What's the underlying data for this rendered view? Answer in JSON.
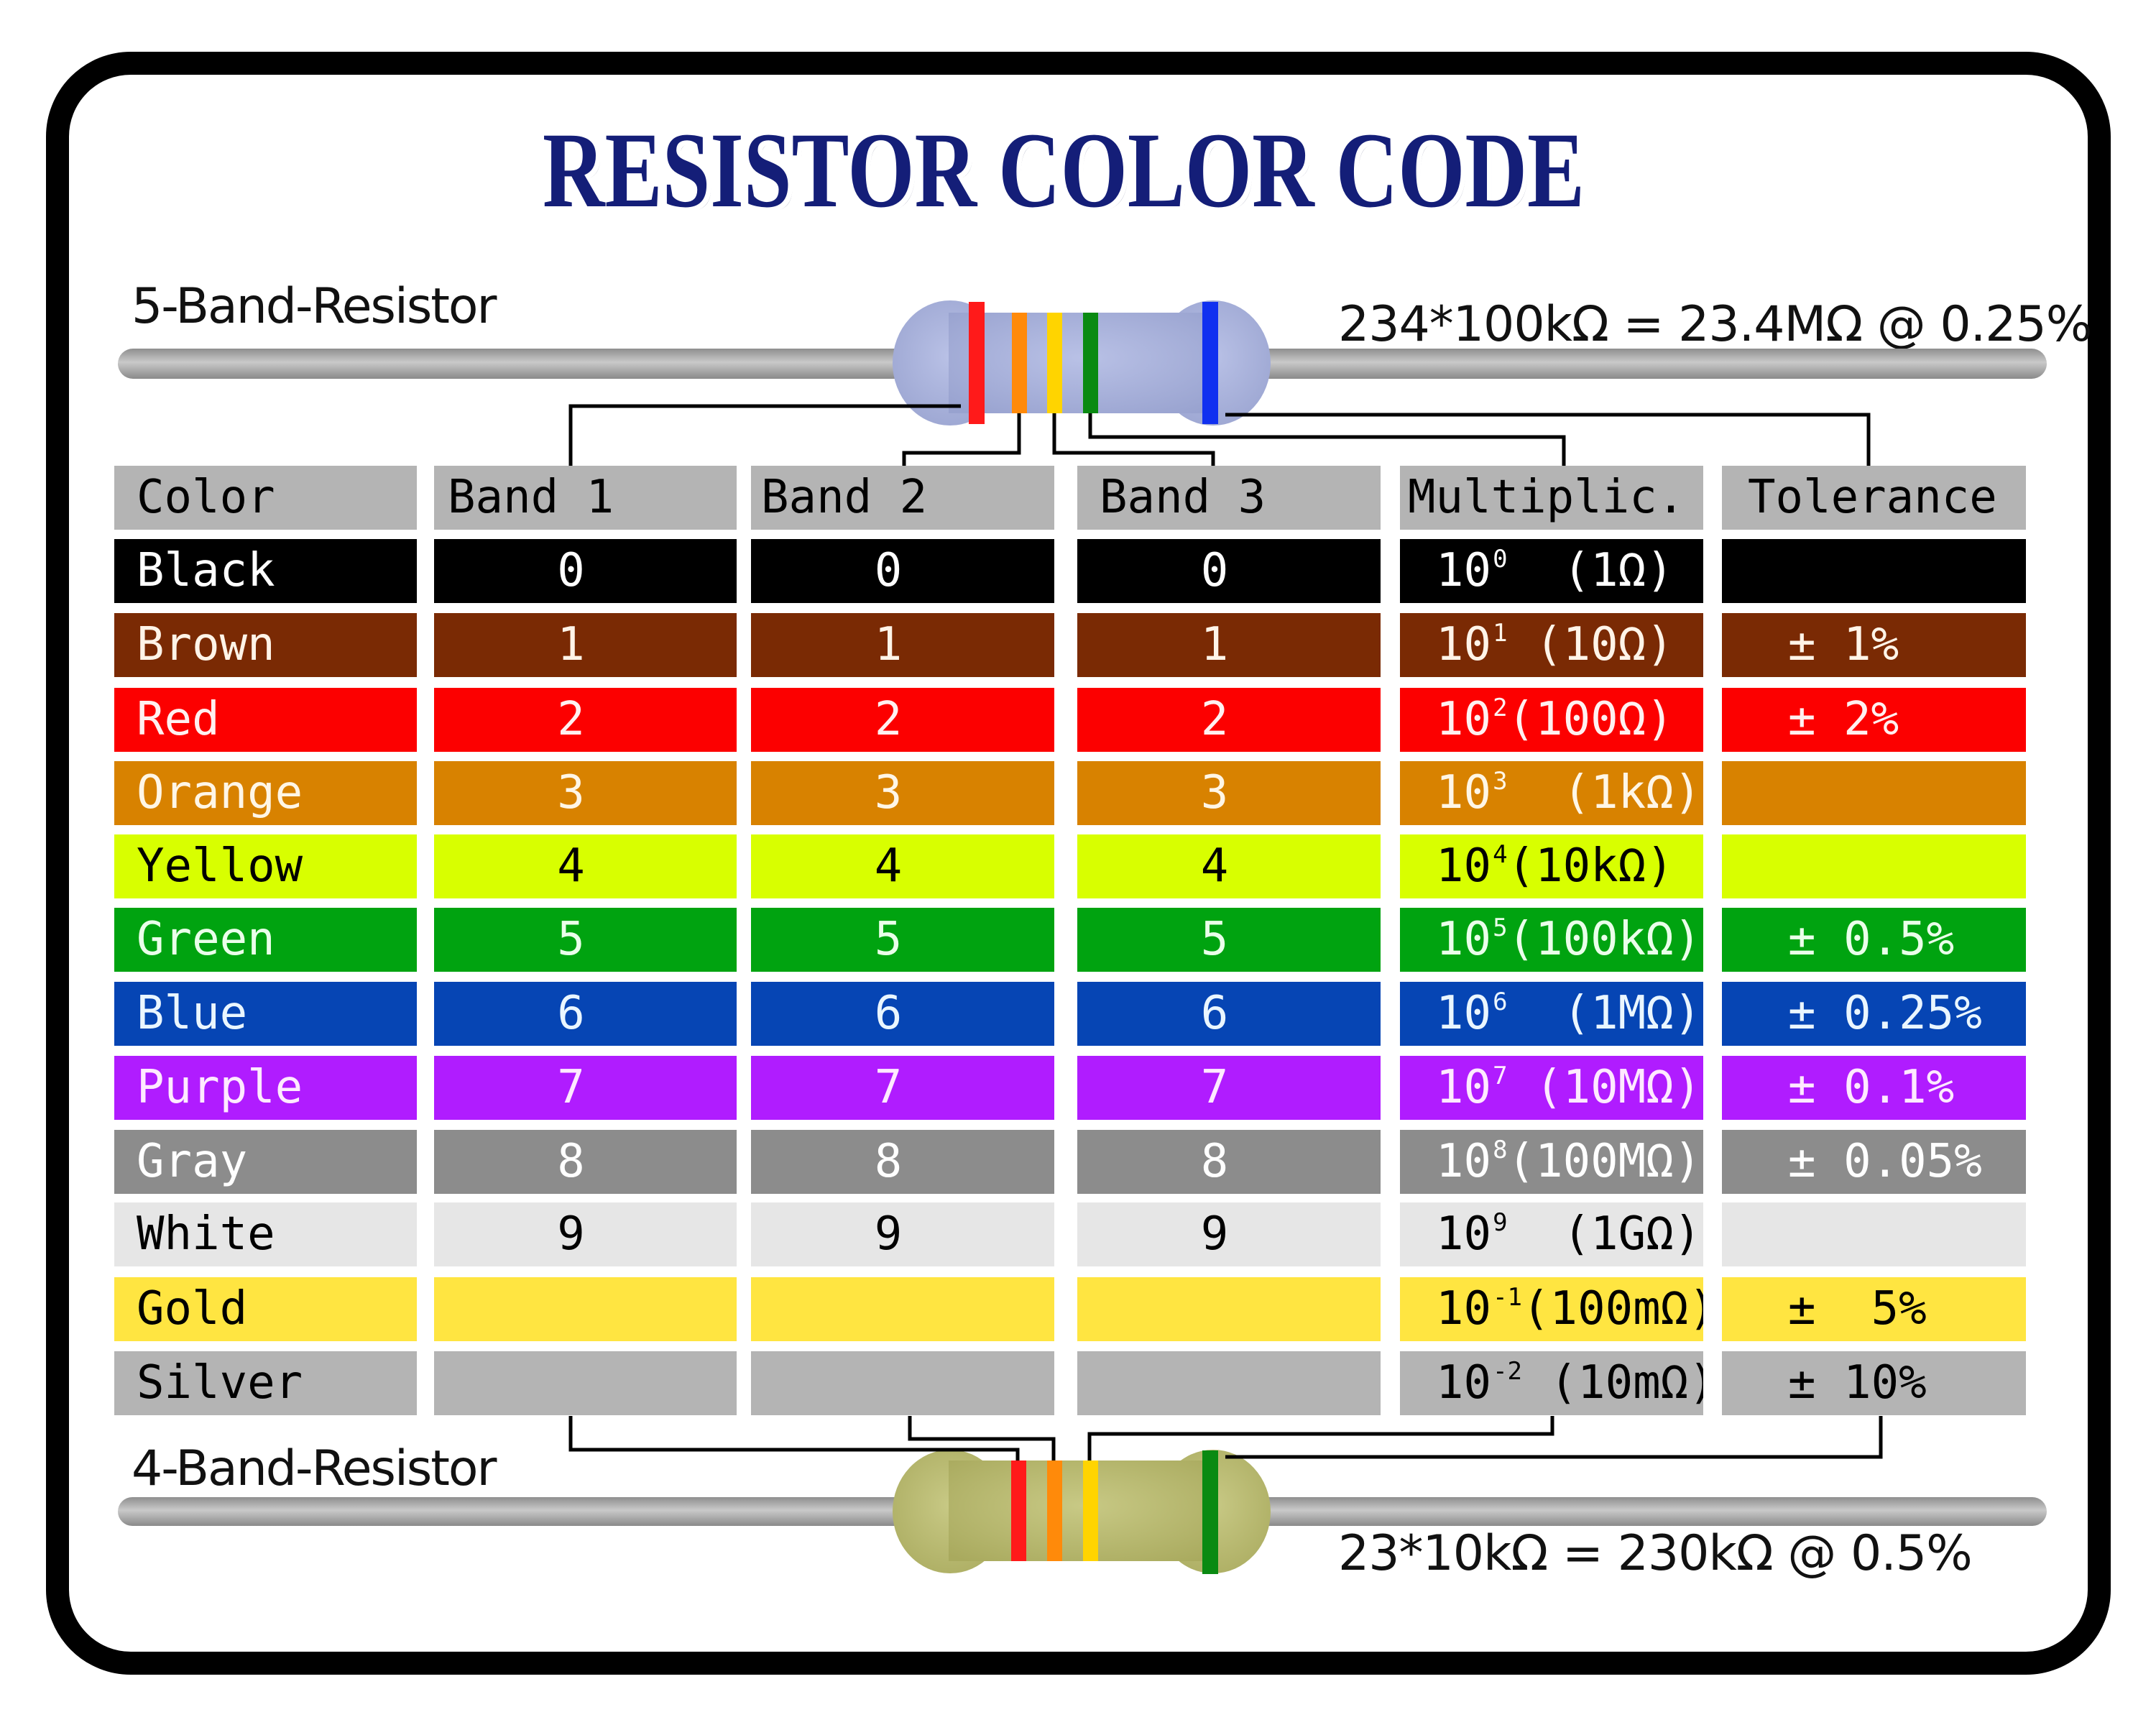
{
  "title": "RESISTOR COLOR CODE",
  "five_band": {
    "label": "5-Band-Resistor",
    "formula": "234*100kΩ = 23.4MΩ @ 0.25%",
    "body_color": "#a9b2da",
    "bands": [
      {
        "role": "Band 1",
        "color_name": "Red",
        "hex": "#ff1a1a"
      },
      {
        "role": "Band 2",
        "color_name": "Orange",
        "hex": "#ff8a0a"
      },
      {
        "role": "Band 3",
        "color_name": "Yellow",
        "hex": "#ffd400"
      },
      {
        "role": "Multiplier",
        "color_name": "Green",
        "hex": "#0a8a12"
      },
      {
        "role": "Tolerance",
        "color_name": "Blue",
        "hex": "#1030f0"
      }
    ]
  },
  "four_band": {
    "label": "4-Band-Resistor",
    "formula": "23*10kΩ = 230kΩ @ 0.5%",
    "body_color": "#b8b970",
    "bands": [
      {
        "role": "Band 1",
        "color_name": "Red",
        "hex": "#ff1a1a"
      },
      {
        "role": "Band 2",
        "color_name": "Orange",
        "hex": "#ff8a0a"
      },
      {
        "role": "Multiplier",
        "color_name": "Yellow",
        "hex": "#ffd400"
      },
      {
        "role": "Tolerance",
        "color_name": "Green",
        "hex": "#0a8a12"
      }
    ]
  },
  "table": {
    "headers": [
      "Color",
      "Band 1",
      "Band 2",
      "Band 3",
      "Multiplic.",
      "Tolerance"
    ],
    "header_bg": "#b4b4b4",
    "rows": [
      {
        "color": "Black",
        "band1": "0",
        "band2": "0",
        "band3": "0",
        "mult_base": "10",
        "mult_exp": "0",
        "mult_value": "  (1Ω)",
        "tolerance": "",
        "bg": "#000000",
        "fg": "#ffffff"
      },
      {
        "color": "Brown",
        "band1": "1",
        "band2": "1",
        "band3": "1",
        "mult_base": "10",
        "mult_exp": "1",
        "mult_value": " (10Ω)",
        "tolerance": "± 1%",
        "bg": "#7a2a04",
        "fg": "#fff4e8"
      },
      {
        "color": "Red",
        "band1": "2",
        "band2": "2",
        "band3": "2",
        "mult_base": "10",
        "mult_exp": "2",
        "mult_value": "(100Ω)",
        "tolerance": "± 2%",
        "bg": "#fc0000",
        "fg": "#fff0f0"
      },
      {
        "color": "Orange",
        "band1": "3",
        "band2": "3",
        "band3": "3",
        "mult_base": "10",
        "mult_exp": "3",
        "mult_value": "  (1kΩ)",
        "tolerance": "",
        "bg": "#d88200",
        "fg": "#fff6e6"
      },
      {
        "color": "Yellow",
        "band1": "4",
        "band2": "4",
        "band3": "4",
        "mult_base": "10",
        "mult_exp": "4",
        "mult_value": "(10kΩ)",
        "tolerance": "",
        "bg": "#d8ff00",
        "fg": "#000000"
      },
      {
        "color": "Green",
        "band1": "5",
        "band2": "5",
        "band3": "5",
        "mult_base": "10",
        "mult_exp": "5",
        "mult_value": "(100kΩ)",
        "tolerance": "± 0.5%",
        "bg": "#00a310",
        "fg": "#eaffea"
      },
      {
        "color": "Blue",
        "band1": "6",
        "band2": "6",
        "band3": "6",
        "mult_base": "10",
        "mult_exp": "6",
        "mult_value": "  (1MΩ)",
        "tolerance": "± 0.25%",
        "bg": "#0645b4",
        "fg": "#eaf6ff"
      },
      {
        "color": "Purple",
        "band1": "7",
        "band2": "7",
        "band3": "7",
        "mult_base": "10",
        "mult_exp": "7",
        "mult_value": " (10MΩ)",
        "tolerance": "± 0.1%",
        "bg": "#b01cff",
        "fg": "#ffeaff"
      },
      {
        "color": "Gray",
        "band1": "8",
        "band2": "8",
        "band3": "8",
        "mult_base": "10",
        "mult_exp": "8",
        "mult_value": "(100MΩ)",
        "tolerance": "± 0.05%",
        "bg": "#8c8c8c",
        "fg": "#ffffff"
      },
      {
        "color": "White",
        "band1": "9",
        "band2": "9",
        "band3": "9",
        "mult_base": "10",
        "mult_exp": "9",
        "mult_value": "  (1GΩ)",
        "tolerance": "",
        "bg": "#e6e6e6",
        "fg": "#000000"
      },
      {
        "color": "Gold",
        "band1": "",
        "band2": "",
        "band3": "",
        "mult_base": "10",
        "mult_exp": "-1",
        "mult_value": "(100mΩ)",
        "tolerance": "±  5%",
        "bg": "#ffe541",
        "fg": "#000000"
      },
      {
        "color": "Silver",
        "band1": "",
        "band2": "",
        "band3": "",
        "mult_base": "10",
        "mult_exp": "-2",
        "mult_value": " (10mΩ)",
        "tolerance": "± 10%",
        "bg": "#b4b4b4",
        "fg": "#000000"
      }
    ]
  }
}
